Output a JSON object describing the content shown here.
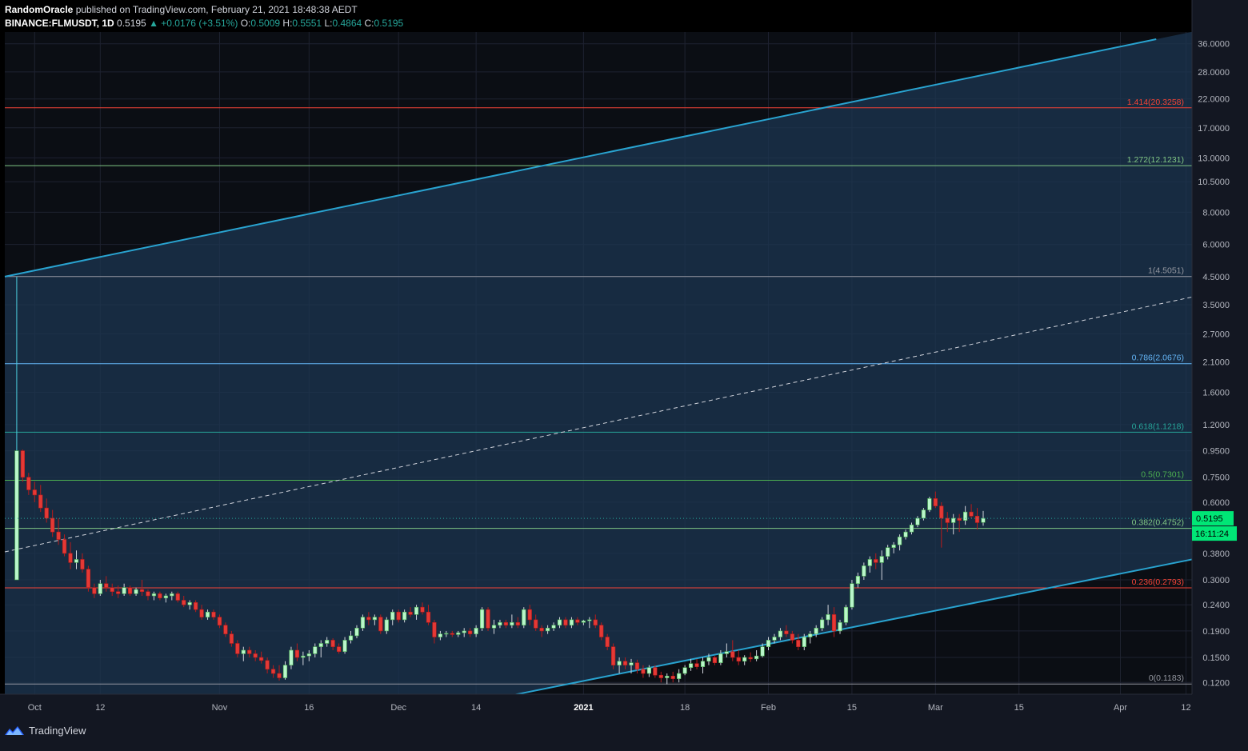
{
  "header": {
    "author": "RandomOracle",
    "published": "published on TradingView.com, February 21, 2021 18:48:38 AEDT",
    "symbol": "BINANCE:FLMUSDT, 1D",
    "last": "0.5195",
    "change": "▲ +0.0176 (+3.51%)",
    "o_label": "O:",
    "o": "0.5009",
    "h_label": "H:",
    "h": "0.5551",
    "l_label": "L:",
    "l": "0.4864",
    "c_label": "C:",
    "c": "0.5195"
  },
  "footer": {
    "brand": "TradingView"
  },
  "colors": {
    "background": "#131722",
    "channel_fill": "#1c3550",
    "channel_line": "#29a3d0",
    "up": "#b9f6ca",
    "down": "#e53935",
    "price_badge": "#00e676",
    "axis_text": "#b2b5be"
  },
  "chart_data": {
    "type": "candlestick",
    "symbol": "BINANCE:FLMUSDT",
    "interval": "1D",
    "y_scale": "log",
    "ylim": [
      0.108,
      40.0
    ],
    "xlim": [
      "2020-09-26",
      "2021-04-13"
    ],
    "y_ticks": [
      "36.0000",
      "28.0000",
      "22.0000",
      "17.0000",
      "13.0000",
      "10.5000",
      "8.0000",
      "6.0000",
      "4.5000",
      "3.5000",
      "2.7000",
      "2.1000",
      "1.6000",
      "1.2000",
      "0.9500",
      "0.7500",
      "0.6000",
      "0.3800",
      "0.3000",
      "0.2400",
      "0.1900",
      "0.1500",
      "0.1200"
    ],
    "x_ticks": [
      {
        "label": "Oct",
        "date": "2020-10-01",
        "bold": false
      },
      {
        "label": "12",
        "date": "2020-10-12",
        "bold": false
      },
      {
        "label": "Nov",
        "date": "2020-11-01",
        "bold": false
      },
      {
        "label": "16",
        "date": "2020-11-16",
        "bold": false
      },
      {
        "label": "Dec",
        "date": "2020-12-01",
        "bold": false
      },
      {
        "label": "14",
        "date": "2020-12-14",
        "bold": false
      },
      {
        "label": "2021",
        "date": "2021-01-01",
        "bold": true
      },
      {
        "label": "18",
        "date": "2021-01-18",
        "bold": false
      },
      {
        "label": "Feb",
        "date": "2021-02-01",
        "bold": false
      },
      {
        "label": "15",
        "date": "2021-02-15",
        "bold": false
      },
      {
        "label": "Mar",
        "date": "2021-03-01",
        "bold": false
      },
      {
        "label": "15",
        "date": "2021-03-15",
        "bold": false
      },
      {
        "label": "Apr",
        "date": "2021-04-01",
        "bold": false
      },
      {
        "label": "12",
        "date": "2021-04-12",
        "bold": false
      }
    ],
    "fib_levels": [
      {
        "label": "1.414(20.3258)",
        "price": 20.3258,
        "color": "#f44336"
      },
      {
        "label": "1.272(12.1231)",
        "price": 12.1231,
        "color": "#81c784"
      },
      {
        "label": "1(4.5051)",
        "price": 4.5051,
        "color": "#9598a1"
      },
      {
        "label": "0.786(2.0676)",
        "price": 2.0676,
        "color": "#64b5f6"
      },
      {
        "label": "0.618(1.1218)",
        "price": 1.1218,
        "color": "#26a69a"
      },
      {
        "label": "0.5(0.7301)",
        "price": 0.7301,
        "color": "#4caf50"
      },
      {
        "label": "0.382(0.4752)",
        "price": 0.4752,
        "color": "#81c784"
      },
      {
        "label": "0.236(0.2793)",
        "price": 0.2793,
        "color": "#f44336"
      },
      {
        "label": "0(0.1183)",
        "price": 0.1183,
        "color": "#9598a1"
      }
    ],
    "channel": {
      "upper": [
        [
          "2020-09-26",
          4.5
        ],
        [
          "2021-04-07",
          37.5
        ]
      ],
      "middle": [
        [
          "2020-09-26",
          0.385
        ],
        [
          "2021-04-13",
          3.75
        ]
      ],
      "lower": [
        [
          "2020-12-20",
          0.107
        ],
        [
          "2021-04-13",
          0.36
        ]
      ]
    },
    "price_label": {
      "value": "0.5195",
      "countdown": "16:11:24"
    },
    "candles": [
      [
        "2020-09-28",
        0.3,
        0.95,
        0.3,
        0.95
      ],
      [
        "2020-09-29",
        0.95,
        0.96,
        0.72,
        0.75
      ],
      [
        "2020-09-30",
        0.75,
        0.78,
        0.64,
        0.67
      ],
      [
        "2020-10-01",
        0.67,
        0.72,
        0.6,
        0.64
      ],
      [
        "2020-10-02",
        0.64,
        0.7,
        0.55,
        0.57
      ],
      [
        "2020-10-03",
        0.57,
        0.62,
        0.5,
        0.52
      ],
      [
        "2020-10-04",
        0.52,
        0.56,
        0.44,
        0.46
      ],
      [
        "2020-10-05",
        0.46,
        0.52,
        0.41,
        0.43
      ],
      [
        "2020-10-06",
        0.43,
        0.45,
        0.37,
        0.38
      ],
      [
        "2020-10-07",
        0.38,
        0.42,
        0.33,
        0.35
      ],
      [
        "2020-10-08",
        0.35,
        0.39,
        0.33,
        0.36
      ],
      [
        "2020-10-09",
        0.36,
        0.38,
        0.32,
        0.33
      ],
      [
        "2020-10-10",
        0.33,
        0.34,
        0.27,
        0.28
      ],
      [
        "2020-10-11",
        0.28,
        0.29,
        0.255,
        0.265
      ],
      [
        "2020-10-12",
        0.265,
        0.3,
        0.26,
        0.29
      ],
      [
        "2020-10-13",
        0.29,
        0.31,
        0.27,
        0.28
      ],
      [
        "2020-10-14",
        0.28,
        0.29,
        0.26,
        0.27
      ],
      [
        "2020-10-15",
        0.27,
        0.285,
        0.255,
        0.265
      ],
      [
        "2020-10-16",
        0.265,
        0.29,
        0.26,
        0.28
      ],
      [
        "2020-10-17",
        0.28,
        0.285,
        0.26,
        0.265
      ],
      [
        "2020-10-18",
        0.265,
        0.28,
        0.26,
        0.275
      ],
      [
        "2020-10-19",
        0.275,
        0.3,
        0.26,
        0.27
      ],
      [
        "2020-10-20",
        0.27,
        0.275,
        0.25,
        0.26
      ],
      [
        "2020-10-21",
        0.26,
        0.27,
        0.25,
        0.265
      ],
      [
        "2020-10-22",
        0.265,
        0.27,
        0.25,
        0.255
      ],
      [
        "2020-10-23",
        0.255,
        0.265,
        0.245,
        0.26
      ],
      [
        "2020-10-24",
        0.26,
        0.27,
        0.25,
        0.265
      ],
      [
        "2020-10-25",
        0.265,
        0.27,
        0.245,
        0.25
      ],
      [
        "2020-10-26",
        0.25,
        0.26,
        0.235,
        0.24
      ],
      [
        "2020-10-27",
        0.24,
        0.25,
        0.23,
        0.245
      ],
      [
        "2020-10-28",
        0.245,
        0.25,
        0.225,
        0.23
      ],
      [
        "2020-10-29",
        0.23,
        0.24,
        0.21,
        0.215
      ],
      [
        "2020-10-30",
        0.215,
        0.23,
        0.21,
        0.225
      ],
      [
        "2020-10-31",
        0.225,
        0.23,
        0.21,
        0.215
      ],
      [
        "2020-11-01",
        0.215,
        0.22,
        0.195,
        0.2
      ],
      [
        "2020-11-02",
        0.2,
        0.205,
        0.18,
        0.185
      ],
      [
        "2020-11-03",
        0.185,
        0.19,
        0.165,
        0.17
      ],
      [
        "2020-11-04",
        0.17,
        0.175,
        0.15,
        0.155
      ],
      [
        "2020-11-05",
        0.155,
        0.165,
        0.145,
        0.16
      ],
      [
        "2020-11-06",
        0.16,
        0.165,
        0.15,
        0.155
      ],
      [
        "2020-11-07",
        0.155,
        0.16,
        0.145,
        0.15
      ],
      [
        "2020-11-08",
        0.15,
        0.158,
        0.142,
        0.146
      ],
      [
        "2020-11-09",
        0.146,
        0.15,
        0.13,
        0.135
      ],
      [
        "2020-11-10",
        0.135,
        0.14,
        0.125,
        0.13
      ],
      [
        "2020-11-11",
        0.13,
        0.14,
        0.122,
        0.125
      ],
      [
        "2020-11-12",
        0.125,
        0.145,
        0.123,
        0.14
      ],
      [
        "2020-11-13",
        0.14,
        0.165,
        0.135,
        0.16
      ],
      [
        "2020-11-14",
        0.16,
        0.17,
        0.145,
        0.15
      ],
      [
        "2020-11-15",
        0.15,
        0.158,
        0.14,
        0.152
      ],
      [
        "2020-11-16",
        0.152,
        0.16,
        0.145,
        0.155
      ],
      [
        "2020-11-17",
        0.155,
        0.17,
        0.15,
        0.165
      ],
      [
        "2020-11-18",
        0.165,
        0.175,
        0.15,
        0.17
      ],
      [
        "2020-11-19",
        0.17,
        0.18,
        0.165,
        0.175
      ],
      [
        "2020-11-20",
        0.175,
        0.178,
        0.16,
        0.165
      ],
      [
        "2020-11-21",
        0.165,
        0.17,
        0.155,
        0.158
      ],
      [
        "2020-11-22",
        0.158,
        0.18,
        0.155,
        0.175
      ],
      [
        "2020-11-23",
        0.175,
        0.19,
        0.17,
        0.182
      ],
      [
        "2020-11-24",
        0.182,
        0.2,
        0.178,
        0.195
      ],
      [
        "2020-11-25",
        0.195,
        0.22,
        0.19,
        0.215
      ],
      [
        "2020-11-26",
        0.215,
        0.225,
        0.2,
        0.21
      ],
      [
        "2020-11-27",
        0.21,
        0.22,
        0.2,
        0.215
      ],
      [
        "2020-11-28",
        0.215,
        0.22,
        0.185,
        0.19
      ],
      [
        "2020-11-29",
        0.19,
        0.215,
        0.185,
        0.21
      ],
      [
        "2020-11-30",
        0.21,
        0.23,
        0.2,
        0.225
      ],
      [
        "2020-12-01",
        0.225,
        0.23,
        0.205,
        0.21
      ],
      [
        "2020-12-02",
        0.21,
        0.23,
        0.205,
        0.225
      ],
      [
        "2020-12-03",
        0.225,
        0.235,
        0.215,
        0.22
      ],
      [
        "2020-12-04",
        0.22,
        0.24,
        0.21,
        0.235
      ],
      [
        "2020-12-05",
        0.235,
        0.245,
        0.22,
        0.225
      ],
      [
        "2020-12-06",
        0.225,
        0.24,
        0.2,
        0.205
      ],
      [
        "2020-12-07",
        0.205,
        0.21,
        0.17,
        0.18
      ],
      [
        "2020-12-08",
        0.18,
        0.19,
        0.175,
        0.185
      ],
      [
        "2020-12-09",
        0.185,
        0.19,
        0.18,
        0.186
      ],
      [
        "2020-12-10",
        0.186,
        0.19,
        0.18,
        0.184
      ],
      [
        "2020-12-11",
        0.184,
        0.19,
        0.18,
        0.187
      ],
      [
        "2020-12-12",
        0.187,
        0.195,
        0.18,
        0.19
      ],
      [
        "2020-12-13",
        0.19,
        0.195,
        0.18,
        0.185
      ],
      [
        "2020-12-14",
        0.185,
        0.2,
        0.18,
        0.195
      ],
      [
        "2020-12-15",
        0.195,
        0.235,
        0.19,
        0.23
      ],
      [
        "2020-12-16",
        0.23,
        0.235,
        0.19,
        0.195
      ],
      [
        "2020-12-17",
        0.195,
        0.21,
        0.185,
        0.2
      ],
      [
        "2020-12-18",
        0.2,
        0.21,
        0.195,
        0.205
      ],
      [
        "2020-12-19",
        0.205,
        0.21,
        0.195,
        0.2
      ],
      [
        "2020-12-20",
        0.2,
        0.22,
        0.195,
        0.205
      ],
      [
        "2020-12-21",
        0.205,
        0.215,
        0.195,
        0.2
      ],
      [
        "2020-12-22",
        0.2,
        0.235,
        0.195,
        0.23
      ],
      [
        "2020-12-23",
        0.23,
        0.24,
        0.2,
        0.21
      ],
      [
        "2020-12-24",
        0.21,
        0.22,
        0.19,
        0.195
      ],
      [
        "2020-12-25",
        0.195,
        0.2,
        0.18,
        0.19
      ],
      [
        "2020-12-26",
        0.19,
        0.2,
        0.185,
        0.195
      ],
      [
        "2020-12-27",
        0.195,
        0.205,
        0.19,
        0.2
      ],
      [
        "2020-12-28",
        0.2,
        0.215,
        0.195,
        0.21
      ],
      [
        "2020-12-29",
        0.21,
        0.215,
        0.195,
        0.2
      ],
      [
        "2020-12-30",
        0.2,
        0.215,
        0.195,
        0.21
      ],
      [
        "2020-12-31",
        0.21,
        0.215,
        0.2,
        0.205
      ],
      [
        "2021-01-01",
        0.205,
        0.21,
        0.2,
        0.208
      ],
      [
        "2021-01-02",
        0.208,
        0.215,
        0.195,
        0.21
      ],
      [
        "2021-01-03",
        0.21,
        0.22,
        0.195,
        0.2
      ],
      [
        "2021-01-04",
        0.2,
        0.205,
        0.175,
        0.18
      ],
      [
        "2021-01-05",
        0.18,
        0.185,
        0.16,
        0.165
      ],
      [
        "2021-01-06",
        0.165,
        0.17,
        0.135,
        0.14
      ],
      [
        "2021-01-07",
        0.14,
        0.15,
        0.13,
        0.145
      ],
      [
        "2021-01-08",
        0.145,
        0.15,
        0.135,
        0.14
      ],
      [
        "2021-01-09",
        0.14,
        0.148,
        0.13,
        0.143
      ],
      [
        "2021-01-10",
        0.143,
        0.147,
        0.13,
        0.135
      ],
      [
        "2021-01-11",
        0.135,
        0.14,
        0.125,
        0.13
      ],
      [
        "2021-01-12",
        0.13,
        0.14,
        0.126,
        0.137
      ],
      [
        "2021-01-13",
        0.137,
        0.14,
        0.125,
        0.128
      ],
      [
        "2021-01-14",
        0.128,
        0.132,
        0.12,
        0.125
      ],
      [
        "2021-01-15",
        0.125,
        0.13,
        0.118,
        0.127
      ],
      [
        "2021-01-16",
        0.127,
        0.132,
        0.12,
        0.124
      ],
      [
        "2021-01-17",
        0.124,
        0.135,
        0.12,
        0.13
      ],
      [
        "2021-01-18",
        0.13,
        0.14,
        0.128,
        0.137
      ],
      [
        "2021-01-19",
        0.137,
        0.148,
        0.133,
        0.142
      ],
      [
        "2021-01-20",
        0.142,
        0.148,
        0.135,
        0.138
      ],
      [
        "2021-01-21",
        0.138,
        0.15,
        0.13,
        0.145
      ],
      [
        "2021-01-22",
        0.145,
        0.155,
        0.14,
        0.15
      ],
      [
        "2021-01-23",
        0.15,
        0.152,
        0.14,
        0.143
      ],
      [
        "2021-01-24",
        0.143,
        0.16,
        0.14,
        0.155
      ],
      [
        "2021-01-25",
        0.155,
        0.17,
        0.15,
        0.158
      ],
      [
        "2021-01-26",
        0.158,
        0.175,
        0.145,
        0.15
      ],
      [
        "2021-01-27",
        0.15,
        0.16,
        0.14,
        0.145
      ],
      [
        "2021-01-28",
        0.145,
        0.153,
        0.14,
        0.15
      ],
      [
        "2021-01-29",
        0.15,
        0.157,
        0.144,
        0.148
      ],
      [
        "2021-01-30",
        0.148,
        0.16,
        0.145,
        0.152
      ],
      [
        "2021-01-31",
        0.152,
        0.17,
        0.15,
        0.165
      ],
      [
        "2021-02-01",
        0.165,
        0.18,
        0.16,
        0.175
      ],
      [
        "2021-02-02",
        0.175,
        0.185,
        0.17,
        0.18
      ],
      [
        "2021-02-03",
        0.18,
        0.195,
        0.175,
        0.19
      ],
      [
        "2021-02-04",
        0.19,
        0.2,
        0.18,
        0.185
      ],
      [
        "2021-02-05",
        0.185,
        0.19,
        0.17,
        0.175
      ],
      [
        "2021-02-06",
        0.175,
        0.185,
        0.16,
        0.165
      ],
      [
        "2021-02-07",
        0.165,
        0.185,
        0.16,
        0.18
      ],
      [
        "2021-02-08",
        0.18,
        0.19,
        0.17,
        0.185
      ],
      [
        "2021-02-09",
        0.185,
        0.2,
        0.18,
        0.195
      ],
      [
        "2021-02-10",
        0.195,
        0.215,
        0.19,
        0.21
      ],
      [
        "2021-02-11",
        0.21,
        0.24,
        0.2,
        0.22
      ],
      [
        "2021-02-12",
        0.22,
        0.235,
        0.18,
        0.19
      ],
      [
        "2021-02-13",
        0.19,
        0.21,
        0.185,
        0.205
      ],
      [
        "2021-02-14",
        0.205,
        0.24,
        0.2,
        0.235
      ],
      [
        "2021-02-15",
        0.235,
        0.3,
        0.23,
        0.29
      ],
      [
        "2021-02-16",
        0.29,
        0.32,
        0.28,
        0.31
      ],
      [
        "2021-02-17",
        0.31,
        0.35,
        0.3,
        0.34
      ],
      [
        "2021-02-18",
        0.34,
        0.37,
        0.32,
        0.36
      ],
      [
        "2021-02-19",
        0.36,
        0.38,
        0.33,
        0.35
      ],
      [
        "2021-02-20",
        0.35,
        0.39,
        0.3,
        0.37
      ],
      [
        "2021-02-21",
        0.37,
        0.41,
        0.36,
        0.4
      ],
      [
        "2021-02-22",
        0.4,
        0.42,
        0.38,
        0.41
      ],
      [
        "2021-02-23",
        0.41,
        0.45,
        0.39,
        0.44
      ],
      [
        "2021-02-24",
        0.44,
        0.47,
        0.43,
        0.46
      ],
      [
        "2021-02-25",
        0.46,
        0.5,
        0.45,
        0.49
      ],
      [
        "2021-02-26",
        0.49,
        0.53,
        0.48,
        0.52
      ],
      [
        "2021-02-27",
        0.52,
        0.57,
        0.51,
        0.56
      ],
      [
        "2021-02-28",
        0.56,
        0.63,
        0.55,
        0.62
      ],
      [
        "2021-03-01",
        0.62,
        0.66,
        0.57,
        0.58
      ],
      [
        "2021-03-02",
        0.58,
        0.6,
        0.4,
        0.52
      ],
      [
        "2021-03-03",
        0.52,
        0.55,
        0.46,
        0.5
      ],
      [
        "2021-03-04",
        0.5,
        0.54,
        0.45,
        0.52
      ],
      [
        "2021-03-05",
        0.52,
        0.54,
        0.46,
        0.51
      ],
      [
        "2021-03-06",
        0.51,
        0.58,
        0.49,
        0.55
      ],
      [
        "2021-03-07",
        0.55,
        0.59,
        0.52,
        0.53
      ],
      [
        "2021-03-08",
        0.53,
        0.57,
        0.47,
        0.5
      ],
      [
        "2021-03-09",
        0.5009,
        0.5551,
        0.4864,
        0.5195
      ]
    ]
  }
}
